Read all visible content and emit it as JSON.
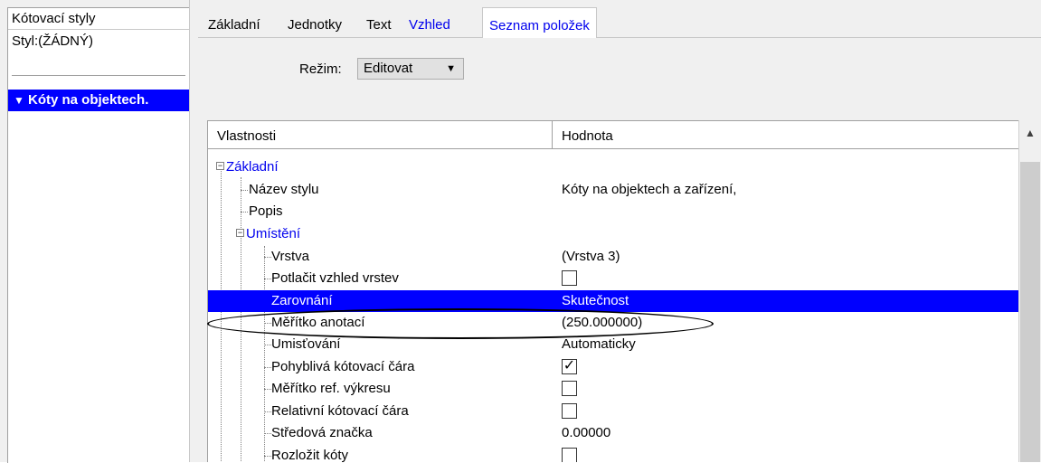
{
  "left_panel": {
    "header": "Kótovací styly",
    "style_label": "Styl:(ŽÁDNÝ)",
    "selected_item": "Kóty na objektech.",
    "selected_item_icon": "filter-icon"
  },
  "tabs": [
    {
      "label": "Základní"
    },
    {
      "label": "Jednotky"
    },
    {
      "label": "Text"
    },
    {
      "label": "Vzhled"
    },
    {
      "label": "Seznam položek"
    }
  ],
  "mode": {
    "label": "Režim:",
    "value": "Editovat"
  },
  "grid": {
    "col_properties": "Vlastnosti",
    "col_value": "Hodnota",
    "rows": [
      {
        "name": "Základní",
        "value": ""
      },
      {
        "name": "Název stylu",
        "value": "Kóty na objektech a zařízení,"
      },
      {
        "name": "Popis",
        "value": ""
      },
      {
        "name": "Umístění",
        "value": ""
      },
      {
        "name": "Vrstva",
        "value": "(Vrstva 3)"
      },
      {
        "name": "Potlačit vzhled vrstev",
        "value": "",
        "checked": false
      },
      {
        "name": "Zarovnání",
        "value": "Skutečnost"
      },
      {
        "name": "Měřítko anotací",
        "value": "(250.000000)"
      },
      {
        "name": "Umisťování",
        "value": "Automaticky"
      },
      {
        "name": "Pohyblivá kótovací čára",
        "value": "",
        "checked": true
      },
      {
        "name": "Měřítko ref. výkresu",
        "value": "",
        "checked": false
      },
      {
        "name": "Relativní kótovací čára",
        "value": "",
        "checked": false
      },
      {
        "name": "Středová značka",
        "value": "0.00000"
      },
      {
        "name": "Rozložit kóty",
        "value": "",
        "checked": false
      }
    ]
  },
  "colors": {
    "selection": "#0000ff",
    "group_text": "#0000ee",
    "panel_bg": "#f0f0f0"
  }
}
